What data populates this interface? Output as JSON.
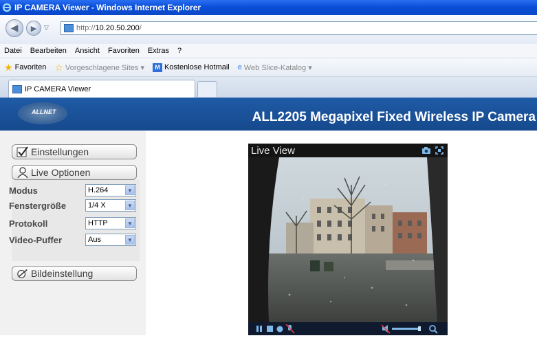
{
  "window": {
    "title": "IP CAMERA Viewer - Windows Internet Explorer"
  },
  "address": {
    "proto": "http://",
    "host": "10.20.50.200",
    "rest": "/"
  },
  "menu": [
    "Datei",
    "Bearbeiten",
    "Ansicht",
    "Favoriten",
    "Extras",
    "?"
  ],
  "favorites_bar": {
    "favorites_label": "Favoriten",
    "suggested": "Vorgeschlagene Sites ▾",
    "hotmail": "Kostenlose Hotmail",
    "webslice": "Web Slice-Katalog ▾"
  },
  "tab": {
    "label": "IP CAMERA Viewer"
  },
  "page": {
    "logo": "ALLNET",
    "title": "ALL2205 Megapixel Fixed Wireless IP Camera"
  },
  "sidebar": {
    "settings_label": "Einstellungen",
    "live_options_label": "Live Optionen",
    "image_settings_label": "Bildeinstellung",
    "options": [
      {
        "label": "Modus",
        "value": "H.264"
      },
      {
        "label": "Fenstergröße",
        "value": "1/4 X"
      },
      {
        "label": "Protokoll",
        "value": "HTTP"
      },
      {
        "label": "Video-Puffer",
        "value": "Aus"
      }
    ]
  },
  "viewer": {
    "title": "Live View"
  }
}
